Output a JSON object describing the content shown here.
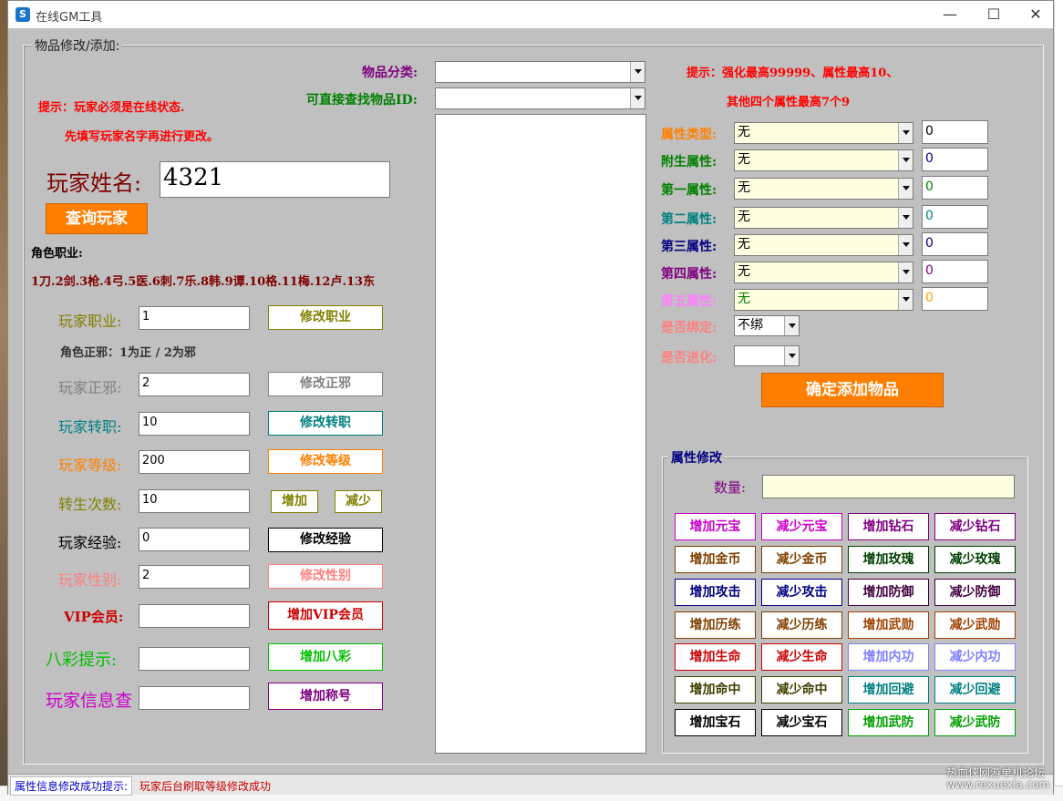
{
  "window": {
    "title": "在线GM工具"
  },
  "groups": {
    "main": "物品修改/添加:",
    "attr": "属性修改"
  },
  "hints": {
    "online": "提示：玩家必须是在线状态.",
    "name_first": "先填写玩家名字再进行更改。",
    "strengthen_1": "提示：强化最高99999、属性最高10、",
    "strengthen_2": "其他四个属性最高7个9"
  },
  "player": {
    "name_label": "玩家姓名:",
    "name_value": "4321",
    "query_button": "查询玩家",
    "job_title": "角色职业:",
    "job_list": "1刀.2剑.3枪.4弓.5医.6刺.7乐.8韩.9谭.10格.11梅.12卢.13东",
    "job_label": "玩家职业:",
    "job_value": "1",
    "job_button": "修改职业",
    "align_hint": "角色正邪：1为正 / 2为邪",
    "align_label": "玩家正邪:",
    "align_value": "2",
    "align_button": "修改正邪",
    "rebirth_label": "玩家转职:",
    "rebirth_value": "10",
    "rebirth_button": "修改转职",
    "level_label": "玩家等级:",
    "level_value": "200",
    "level_button": "修改等级",
    "rebirth_count_label": "转生次数:",
    "rebirth_count_value": "10",
    "rebirth_add": "增加",
    "rebirth_sub": "减少",
    "exp_label": "玩家经验:",
    "exp_value": "0",
    "exp_button": "修改经验",
    "gender_label": "玩家性别:",
    "gender_value": "2",
    "gender_button": "修改性别",
    "vip_label": "VIP会员:",
    "vip_value": "",
    "vip_button": "增加VIP会员",
    "bacai_label": "八彩提示:",
    "bacai_value": "",
    "bacai_button": "增加八彩",
    "info_label": "玩家信息查",
    "info_value": "",
    "info_button": "增加称号"
  },
  "item": {
    "category_label": "物品分类:",
    "category_value": "",
    "find_id_label": "可直接查找物品ID:",
    "find_id_value": ""
  },
  "attributes": [
    {
      "label": "属性类型:",
      "value": "无",
      "num": "0",
      "color": "#ff8000",
      "num_color": "#000000"
    },
    {
      "label": "附生属性:",
      "value": "无",
      "num": "0",
      "color": "#008000",
      "num_color": "#000080"
    },
    {
      "label": "第一属性:",
      "value": "无",
      "num": "0",
      "color": "#008000",
      "num_color": "#008000"
    },
    {
      "label": "第二属性:",
      "value": "无",
      "num": "0",
      "color": "#008080",
      "num_color": "#008080"
    },
    {
      "label": "第三属性:",
      "value": "无",
      "num": "0",
      "color": "#000080",
      "num_color": "#000080"
    },
    {
      "label": "第四属性:",
      "value": "无",
      "num": "0",
      "color": "#800080",
      "num_color": "#800080"
    },
    {
      "label": "第五属性:",
      "value": "无",
      "num": "0",
      "color": "#ff80ff",
      "num_color": "#ffa000"
    }
  ],
  "bind": {
    "label": "是否绑定:",
    "value": "不绑"
  },
  "evolve": {
    "label": "是否进化:",
    "value": ""
  },
  "add_item_button": "确定添加物品",
  "quantity": {
    "label": "数量:",
    "value": ""
  },
  "attr_buttons": [
    [
      {
        "label": "增加元宝",
        "color": "#cc00cc"
      },
      {
        "label": "减少元宝",
        "color": "#cc00cc"
      },
      {
        "label": "增加钻石",
        "color": "#800080"
      },
      {
        "label": "减少钻石",
        "color": "#800080"
      }
    ],
    [
      {
        "label": "增加金币",
        "color": "#804000"
      },
      {
        "label": "减少金币",
        "color": "#804000"
      },
      {
        "label": "增加玫瑰",
        "color": "#004000"
      },
      {
        "label": "减少玫瑰",
        "color": "#004000"
      }
    ],
    [
      {
        "label": "增加攻击",
        "color": "#000080"
      },
      {
        "label": "减少攻击",
        "color": "#000080"
      },
      {
        "label": "增加防御",
        "color": "#400040"
      },
      {
        "label": "减少防御",
        "color": "#400040"
      }
    ],
    [
      {
        "label": "增加历练",
        "color": "#804000"
      },
      {
        "label": "减少历练",
        "color": "#804000"
      },
      {
        "label": "增加武勋",
        "color": "#a04000"
      },
      {
        "label": "减少武勋",
        "color": "#a04000"
      }
    ],
    [
      {
        "label": "增加生命",
        "color": "#cc0000"
      },
      {
        "label": "减少生命",
        "color": "#cc0000"
      },
      {
        "label": "增加内功",
        "color": "#8080ff"
      },
      {
        "label": "减少内功",
        "color": "#8080ff"
      }
    ],
    [
      {
        "label": "增加命中",
        "color": "#404000"
      },
      {
        "label": "减少命中",
        "color": "#404000"
      },
      {
        "label": "增加回避",
        "color": "#008080"
      },
      {
        "label": "减少回避",
        "color": "#008080"
      }
    ],
    [
      {
        "label": "增加宝石",
        "color": "#000000"
      },
      {
        "label": "减少宝石",
        "color": "#000000"
      },
      {
        "label": "增加武防",
        "color": "#00a000"
      },
      {
        "label": "减少武防",
        "color": "#00a000"
      }
    ]
  ],
  "status": {
    "label": "属性信息修改成功提示:",
    "message": "玩家后台刷取等级修改成功"
  },
  "watermark": {
    "line1": "热血侠网游单机论坛",
    "line2": "www.rexuexia.com"
  },
  "colors": {
    "hint_red": "#ff0000",
    "job_purple": "#800080",
    "find_id_green": "#008000",
    "name_label": "#800000",
    "job_label": "#808000",
    "align_label": "#808080",
    "rebirth_label": "#008080",
    "level_label": "#ff8000",
    "rebirth_count_label": "#808000",
    "exp_label": "#000000",
    "gender_label": "#ff8080",
    "vip_label": "#cc0000",
    "bacai_label": "#00c000",
    "info_label": "#cc00cc",
    "disabled_label": "#ff8080",
    "attr_combo_bg": "#ffffe1"
  }
}
